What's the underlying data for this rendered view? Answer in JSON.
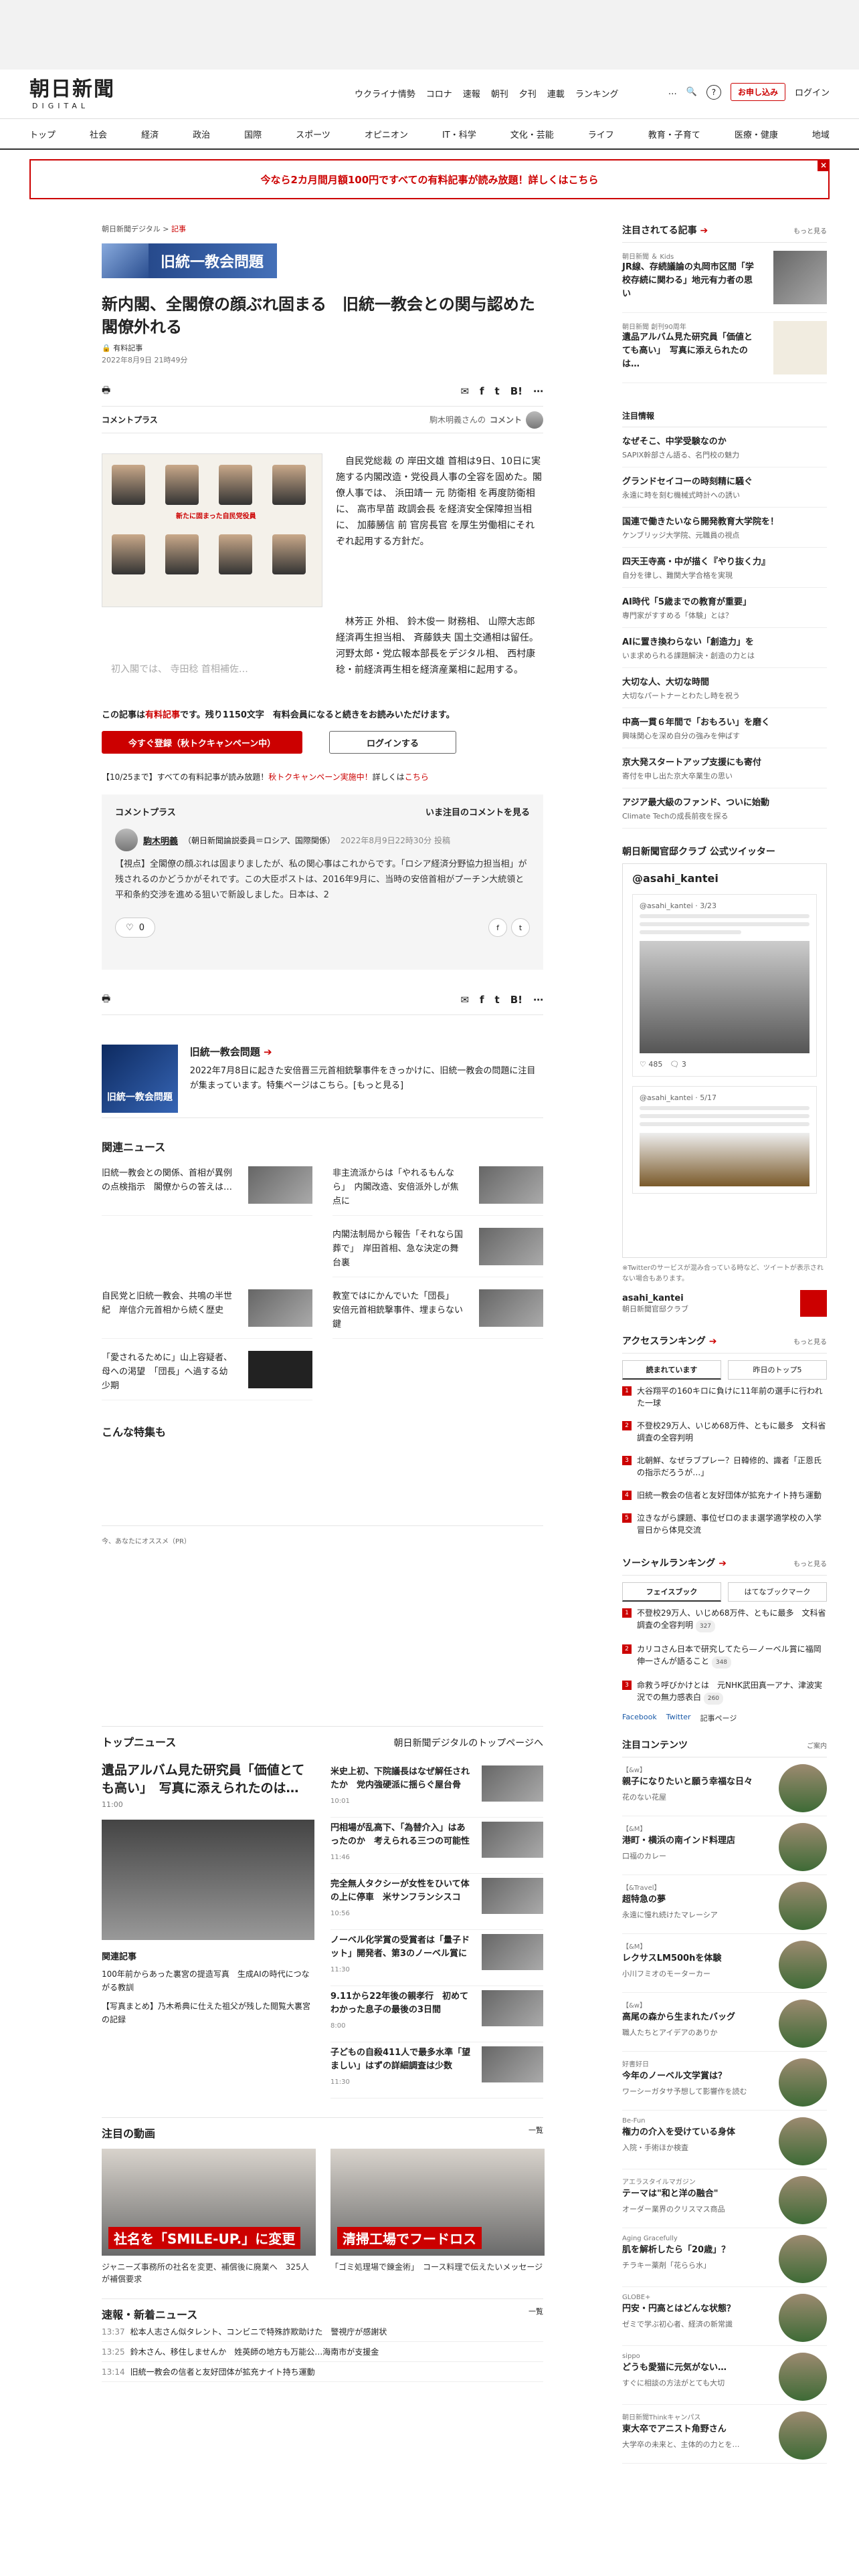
{
  "header": {
    "logo_main": "朝日新聞",
    "logo_sub": "DIGITAL",
    "nav": [
      "ウクライナ情勢",
      "コロナ",
      "速報",
      "朝刊",
      "夕刊",
      "連載",
      "ランキング"
    ],
    "more": "…",
    "subscribe": "お申し込み",
    "login": "ログイン"
  },
  "categories": [
    "トップ",
    "社会",
    "経済",
    "政治",
    "国際",
    "スポーツ",
    "オピニオン",
    "IT・科学",
    "文化・芸能",
    "ライフ",
    "教育・子育て",
    "医療・健康",
    "地域"
  ],
  "promo": "今なら2カ月間月額100円ですべての有料記事が読み放題！詳しくはこちら",
  "article": {
    "breadcrumb_site": "朝日新聞デジタル",
    "breadcrumb_sep": ">",
    "breadcrumb_section": "記事",
    "banner": "旧統一教会問題",
    "title": "新内閣、全閣僚の顔ぶれ固まる　旧統一教会との関与認めた閣僚外れる",
    "paid": "有料記事",
    "date": "2022年8月9日 21時49分",
    "comment_plus": "コメントプラス",
    "commenter_ref": "駒木明義さんの",
    "commenter_ref_link": "コメント",
    "body1": "　自民党総裁 の 岸田文雄 首相は9日、10日に実施する内閣改造・党役員人事の全容を固めた。閣僚人事では、 浜田靖一 元 防衛相 を再度防衛相に、 高市早苗 政調会長 を経済安全保障担当相に、 加藤勝信 前 官房長官 を厚生労働相にそれぞれ起用する方針だ。",
    "body2": "　林芳正 外相、 鈴木俊一 財務相、 山際大志郎 経済再生担当相、 斉藤鉄夫 国土交通相は留任。 河野太郎・党広報本部長をデジタル相、 西村康稔・前経済再生相を経済産業相に起用する。",
    "body_fade": "　初入閣では、 寺田稔 首相補佐…",
    "paywall_text_a": "この記事は",
    "paywall_text_b": "有料記事",
    "paywall_text_c": "です。残り1150文字　有料会員になると続きをお読みいただけます。",
    "register_btn": "今すぐ登録（秋トクキャンペーン中）",
    "login_btn": "ログインする",
    "campaign_a": "【10/25まで】すべての有料記事が読み放題！",
    "campaign_b": "秋トクキャンペーン実施中！",
    "campaign_c": "詳しくは",
    "campaign_d": "こちら",
    "photo_caption": "新たに固まった自民党役員"
  },
  "comment": {
    "header": "コメントプラス",
    "see_all": "いま注目のコメントを見る",
    "name": "駒木明義",
    "affil": "（朝日新聞論説委員＝ロシア、国際関係）",
    "time": "2022年8月9日22時30分 投稿",
    "text": "【視点】全閣僚の顔ぶれは固まりましたが、私の関心事はこれからです。「ロシア経済分野協力担当相」が残されるのかどうかがそれです。この大臣ポストは、2016年9月に、当時の安倍首相がプーチン大統領と平和条約交渉を進める狙いで新設しました。日本は、2",
    "likes": "0"
  },
  "feature": {
    "title": "旧統一教会問題",
    "img_label": "旧統一教会問題",
    "text": "2022年7月8日に起きた安倍晋三元首相銃撃事件をきっかけに、旧統一教会の問題に注目が集まっています。特集ページはこちら。[もっと見る]"
  },
  "related": {
    "heading": "関連ニュース",
    "items": [
      "旧統一教会との関係、首相が異例の点検指示　閣僚からの答えは…",
      "非主流派からは「やれるもんなら」　内閣改造、安倍派外しが焦点に",
      "",
      "内閣法制局から報告「それなら国葬で」　岸田首相、急な決定の舞台裏",
      "自民党と旧統一教会、共鳴の半世紀　岸信介元首相から続く歴史",
      "教室ではにかんでいた「団長」　安倍元首相銃撃事件、埋まらない鍵",
      "「愛されるために」山上容疑者、母への渇望　「団長」へ過する幼少期",
      ""
    ]
  },
  "specials_heading": "こんな特集も",
  "recommend_heading": "今、あなたにオススメ（PR）",
  "top_news": {
    "heading": "トップニュース",
    "more": "朝日新聞デジタルのトップページへ",
    "lead": "遺品アルバム見た研究員「価値とても高い」　写真に添えられたのは…",
    "lead_time": "11:00",
    "related_heading": "関連記事",
    "related": [
      "100年前からあった裏宮の提造写真　生成AIの時代につながる教訓",
      "【写真まとめ】乃木希典に仕えた祖父が残した閲覧大裏宮の記録"
    ],
    "right": [
      {
        "t": "米史上初、下院議長はなぜ解任されたか　党内強硬派に揺らぐ屋台骨",
        "tm": "10:01"
      },
      {
        "t": "円相場が乱高下、「為替介入」はあったのか　考えられる三つの可能性",
        "tm": "11:46"
      },
      {
        "t": "完全無人タクシーが女性をひいて体の上に停車　米サンフランシスコ",
        "tm": "10:56"
      },
      {
        "t": "ノーベル化学賞の受賞者は「量子ドット」開発者、第3のノーベル賞に",
        "tm": "11:30"
      },
      {
        "t": "9.11から22年後の親孝行　初めてわかった息子の最後の3日間",
        "tm": "8:00"
      },
      {
        "t": "子どもの自殺411人で最多水準「望ましい」はずの詳細調査は少数",
        "tm": "11:30"
      }
    ]
  },
  "videos": {
    "heading": "注目の動画",
    "more": "一覧",
    "items": [
      {
        "cap": "社名を「SMILE-UP.」に変更",
        "t": "ジャニーズ事務所の社名を変更、補償後に廃業へ　325人が補償要求"
      },
      {
        "cap": "清掃工場でフードロス",
        "t": "「ゴミ処理場で錬金術」　コース料理で伝えたいメッセージ"
      }
    ]
  },
  "breaking": {
    "heading": "速報・新着ニュース",
    "more": "一覧",
    "items": [
      {
        "tm": "13:37",
        "t": "松本人志さん似タレント、コンビニで特殊詐欺助けた　警視庁が感謝状"
      },
      {
        "tm": "13:25",
        "t": "鈴木さん、移住しませんか　姓英師の地方も万能公…海南市が支援金"
      },
      {
        "tm": "13:14",
        "t": "旧統一教会の信者と友好団体が拡充ナイト持ち運動"
      }
    ]
  },
  "side": {
    "attn_heading": "注目されてる記事",
    "attn_more": "もっと見る",
    "attn": [
      {
        "src": "朝日新聞 ＆ Kids",
        "t": "JR線、存続議論の丸岡市区間「学校存続に関わる」地元有力者の思い"
      },
      {
        "src": "朝日新聞 創刊90周年",
        "t": "遺品アルバム見た研究員「価値とても高い」　写真に添えられたのは…"
      }
    ],
    "pr_heading": "注目情報",
    "pr": [
      {
        "t": "なぜそこ、中学受験なのか",
        "s": "SAPIX幹部さん語る、名門校の魅力"
      },
      {
        "t": "グランドセイコーの時刻精に騒ぐ",
        "s": "永遠に時を刻む機械式時計への誘い"
      },
      {
        "t": "国連で働きたいなら開発教育大学院を！",
        "s": "ケンブリッジ大学院、元職員の視点"
      },
      {
        "t": "四天王寺高・中が描く『やり抜く力』",
        "s": "自分を律し、難関大学合格を実現"
      },
      {
        "t": "AI時代「5歳までの教育が重要」",
        "s": "専門家がすすめる「体験」とは？"
      },
      {
        "t": "AIに置き換わらない「創造力」を",
        "s": "いま求められる課題解決・創造の力とは"
      },
      {
        "t": "大切な人、大切な時間",
        "s": "大切なパートナーとわたし時を祝う"
      },
      {
        "t": "中高一貫６年間で「おもろい」を磨く",
        "s": "興味関心を深め自分の強みを伸ばす"
      },
      {
        "t": "京大発スタートアップ支援にも寄付",
        "s": "寄付を申し出た京大卒業生の思い"
      },
      {
        "t": "アジア最大級のファンド、ついに始動",
        "s": "Climate Techの成長前夜を探る"
      }
    ],
    "twitter_heading": "朝日新聞官邸クラブ 公式ツイッター",
    "tw_name": "@asahi_kantei",
    "tw_handle1": "@asahi_kantei · 3/23",
    "tw_likes1": "485",
    "tw_replies1": "3",
    "tw_handle2": "@asahi_kantei · 5/17",
    "tw_note": "※Twitterのサービスが混み合っている時など、ツイートが表示されない場合もあります。",
    "tw_author": "asahi_kantei",
    "tw_author_sub": "朝日新聞官邸クラブ",
    "ranking_heading": "アクセスランキング",
    "ranking_more": "もっと見る",
    "ranking_tabs": [
      "読まれています",
      "昨日のトップ5"
    ],
    "ranking": [
      "大谷翔平の160キロに負けに11年前の選手に行われた一球",
      "不登校29万人、いじめ68万件、ともに最多　文科省調査の全容判明",
      "北朝鮮、なぜラブプレー？日韓修的、識者「正恩氏の指示だろうが…」",
      "旧統一教会の信者と友好団体が拡充ナイト持ち運動",
      "泣きながら課題、事位ゼロのまま選学適学校の入学冒日から体見交流"
    ],
    "social_heading": "ソーシャルランキング",
    "social_more": "もっと見る",
    "social_tabs": [
      "フェイスブック",
      "はてなブックマーク"
    ],
    "social": [
      {
        "t": "不登校29万人、いじめ68万件、ともに最多　文科省調査の全容判明",
        "c": "327"
      },
      {
        "t": "カリコさん日本で研究してたら—ノーベル賞に福岡伸一さんが語ること",
        "c": "348"
      },
      {
        "t": "命救う呼びかけとは　元NHK武田真一アナ、津波実況での無力感表白",
        "c": "260"
      }
    ],
    "social_fb": "Facebook",
    "social_tw": "Twitter",
    "social_mail": "記事ページ",
    "cc_heading": "注目コンテンツ",
    "cc_more": "ご案内",
    "cc": [
      {
        "src": "【&w】",
        "t": "親子になりたいと願う幸福な日々",
        "s": "花のない花屋"
      },
      {
        "src": "【&M】",
        "t": "港町・横浜の南インド料理店",
        "s": "口福のカレー"
      },
      {
        "src": "【&Travel】",
        "t": "超特急の夢",
        "s": "永遠に憧れ続けたマレーシア"
      },
      {
        "src": "【&M】",
        "t": "レクサスLM500hを体験",
        "s": "小川フミオのモーターカー"
      },
      {
        "src": "【&w】",
        "t": "高尾の森から生まれたバッグ",
        "s": "職人たちとアイデアのありか"
      },
      {
        "src": "好書好日",
        "t": "今年のノーベル文学賞は？",
        "s": "ワーシーガタサ予想して影響作を読む"
      },
      {
        "src": "Be-Fun",
        "t": "権力の介入を受けている身体",
        "s": "入院・手術ほか検査"
      },
      {
        "src": "アエラスタイルマガジン",
        "t": "テーマは\"和と洋の融合\"",
        "s": "オーダー業界のクリスマス商品"
      },
      {
        "src": "Aging Gracefully",
        "t": "肌を解析したら「20歳」？",
        "s": "チラキー薬剤「花らら水」"
      },
      {
        "src": "GLOBE+",
        "t": "円安・円高とはどんな状態？",
        "s": "ゼミで学ぶ初心者、経済の新常識"
      },
      {
        "src": "sippo",
        "t": "どうも愛猫に元気がない…",
        "s": "すぐに相談の方法がとても大切"
      },
      {
        "src": "朝日新聞Thinkキャンパス",
        "t": "東大卒でアニスト角野さん",
        "s": "大学卒の未来と、主体的の力とを…"
      }
    ]
  }
}
